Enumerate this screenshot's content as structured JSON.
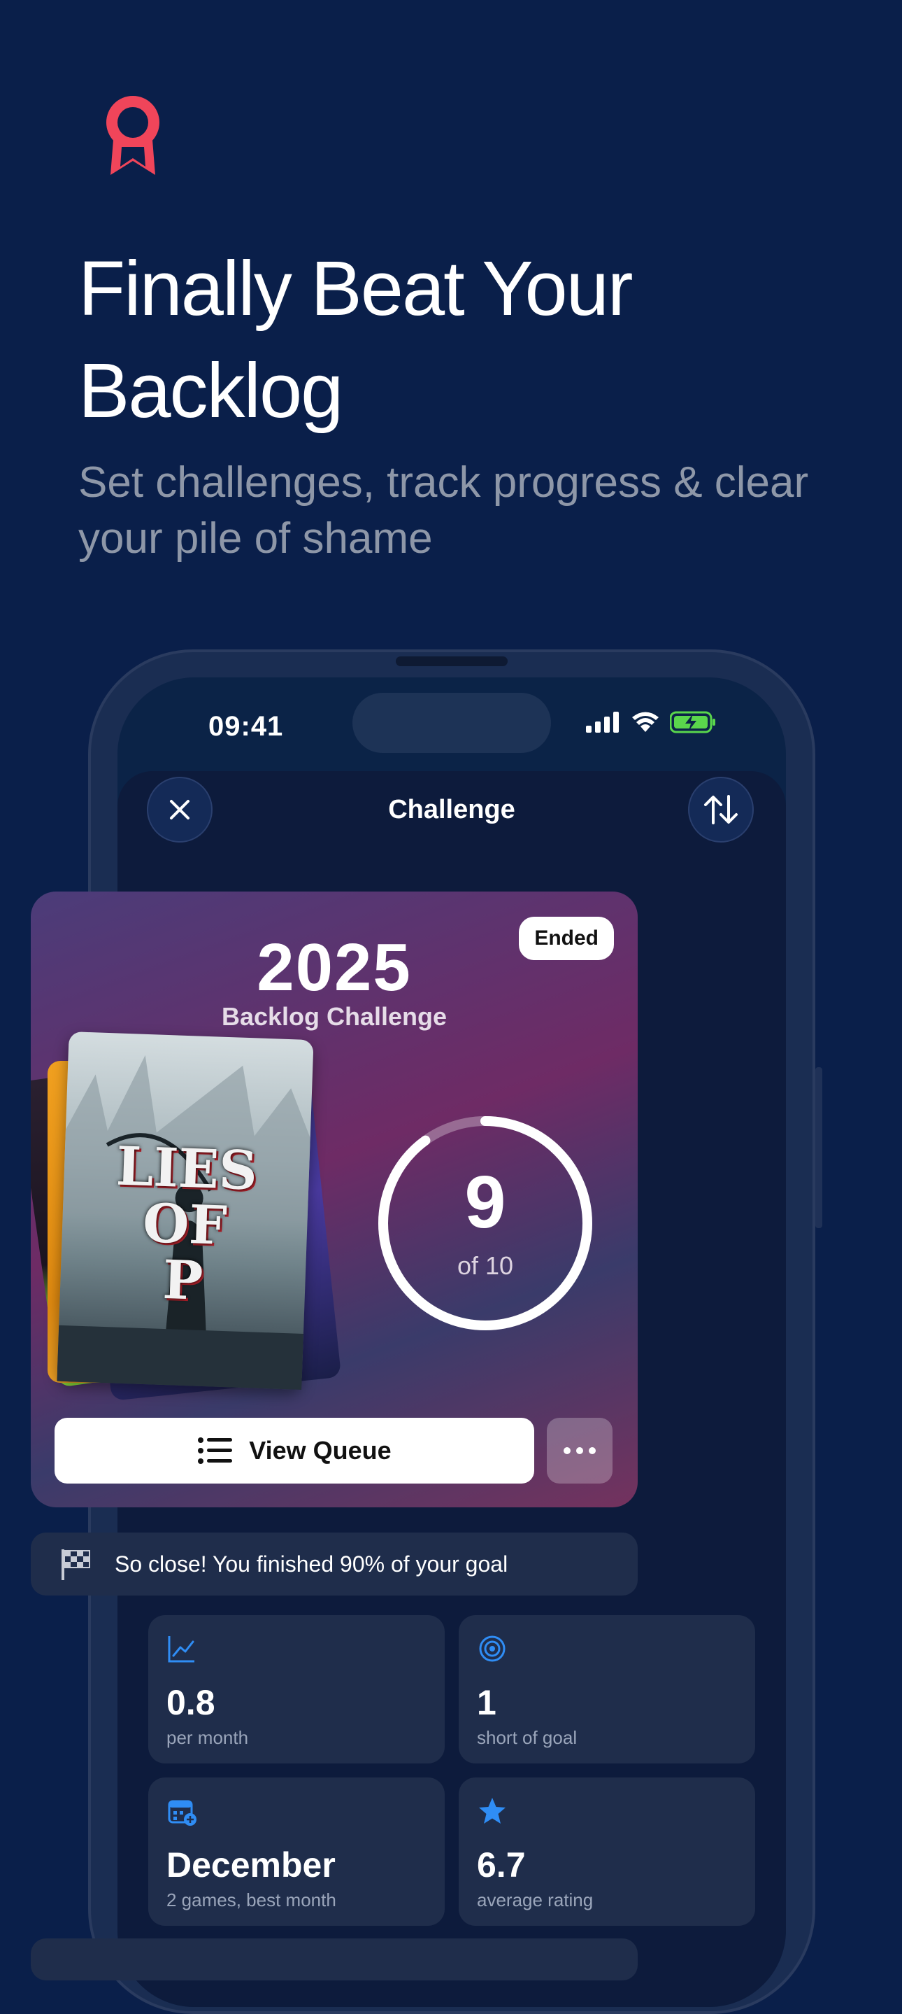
{
  "promo": {
    "headline_line1": "Finally Beat Your",
    "headline_line2": "Backlog",
    "subheadline": "Set challenges, track progress & clear your pile of shame",
    "icon": "ribbon-award-icon",
    "accent_color": "#f0455a"
  },
  "status_bar": {
    "time": "09:41",
    "icons": [
      "signal-icon",
      "wifi-icon",
      "battery-charging-icon"
    ]
  },
  "sheet": {
    "title": "Challenge",
    "close_icon": "close-icon",
    "sort_icon": "sort-arrows-icon"
  },
  "challenge": {
    "status_badge": "Ended",
    "year": "2025",
    "name": "Backlog Challenge",
    "completed": "9",
    "goal_text": "of 10",
    "completed_count": 9,
    "goal_count": 10,
    "progress_fraction": 0.9,
    "cover_title": "LIES OF P",
    "view_queue_label": "View Queue",
    "more_icon": "more-dots-icon"
  },
  "banner": {
    "icon": "checkered-flag-icon",
    "text": "So close! You finished 90% of your goal"
  },
  "stats": [
    {
      "icon": "trend-chart-icon",
      "value": "0.8",
      "label": "per month"
    },
    {
      "icon": "target-icon",
      "value": "1",
      "label": "short of goal"
    },
    {
      "icon": "calendar-icon",
      "value": "December",
      "label": "2 games, best month"
    },
    {
      "icon": "star-icon",
      "value": "6.7",
      "label": "average rating"
    }
  ]
}
